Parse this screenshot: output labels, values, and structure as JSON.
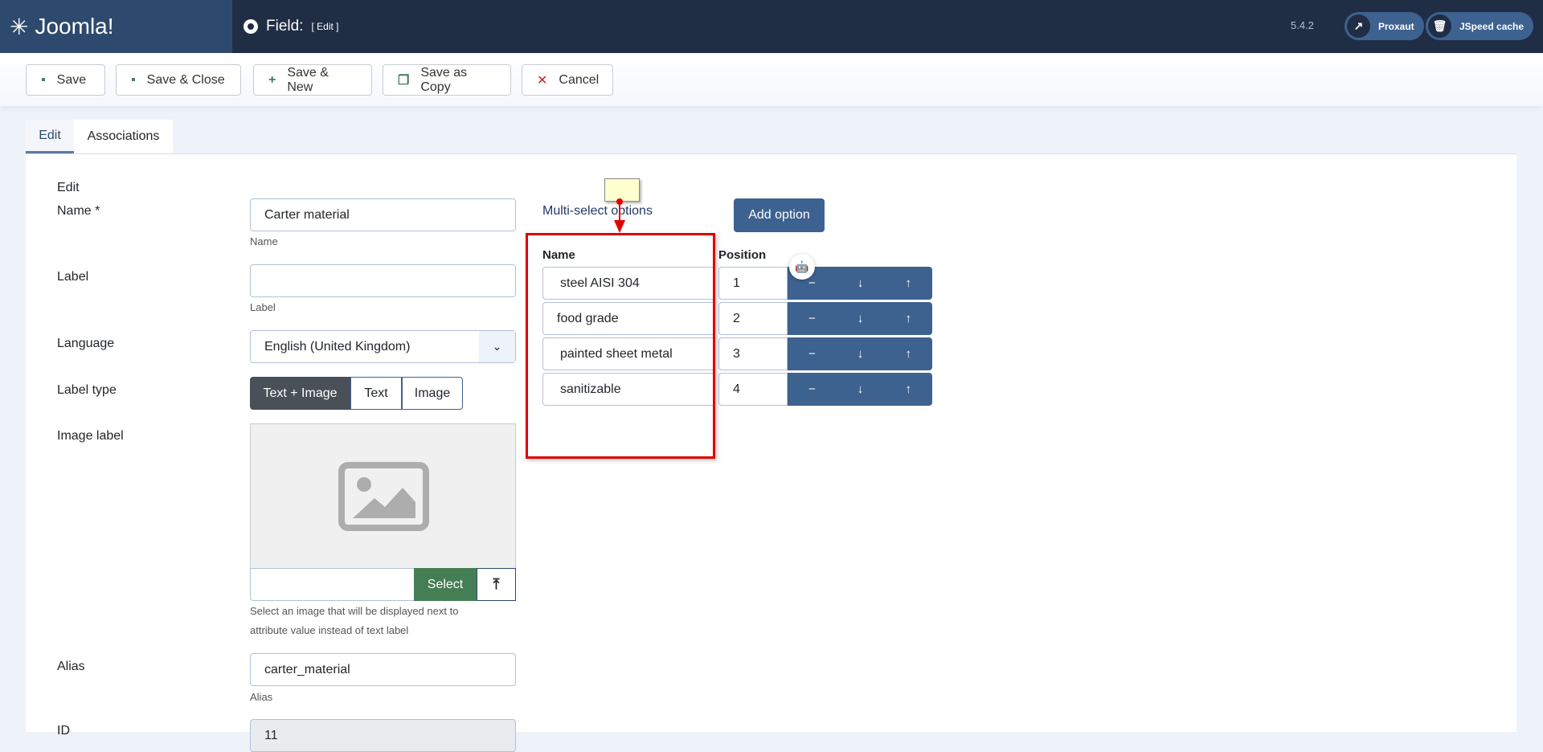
{
  "header": {
    "brand": "Joomla!",
    "title": "Field:",
    "title_sub": "[ Edit ]",
    "version": "5.4.2",
    "buttons": [
      {
        "label": "Proxaut",
        "icon": "external-link-icon"
      },
      {
        "label": "JSpeed cache",
        "icon": "trash-icon"
      }
    ]
  },
  "toolbar": {
    "save": "Save",
    "save_close": "Save & Close",
    "save_new": "Save & New",
    "save_copy": "Save as Copy",
    "cancel": "Cancel"
  },
  "tabs": [
    {
      "label": "Edit",
      "active": true
    },
    {
      "label": "Associations",
      "active": false
    }
  ],
  "form": {
    "section": "Edit",
    "name": {
      "label": "Name *",
      "value": "Carter material",
      "help": "Name"
    },
    "label": {
      "label": "Label",
      "value": "",
      "help": "Label"
    },
    "language": {
      "label": "Language",
      "value": "English (United Kingdom)"
    },
    "label_type": {
      "label": "Label type",
      "options": [
        "Text + Image",
        "Text",
        "Image"
      ],
      "selected": "Text + Image"
    },
    "image_label": {
      "label": "Image label",
      "select": "Select",
      "help1": "Select an image that will be displayed next to",
      "help2": "attribute value instead of text label"
    },
    "alias": {
      "label": "Alias",
      "value": "carter_material",
      "help": "Alias"
    },
    "id": {
      "label": "ID",
      "value": "11"
    }
  },
  "options": {
    "title": "Multi-select options",
    "add": "Add option",
    "col_name": "Name",
    "col_position": "Position",
    "remove": "−",
    "down": "↓",
    "up": "↑",
    "rows": [
      {
        "name": "steel AISI 304",
        "position": "1"
      },
      {
        "name": "food grade",
        "position": "2"
      },
      {
        "name": "painted sheet metal",
        "position": "3"
      },
      {
        "name": "sanitizable",
        "position": "4"
      }
    ]
  },
  "colors": {
    "header": "#1f2d45",
    "primary": "#3d6290",
    "success": "#457d54",
    "annotation": "#e00000"
  }
}
